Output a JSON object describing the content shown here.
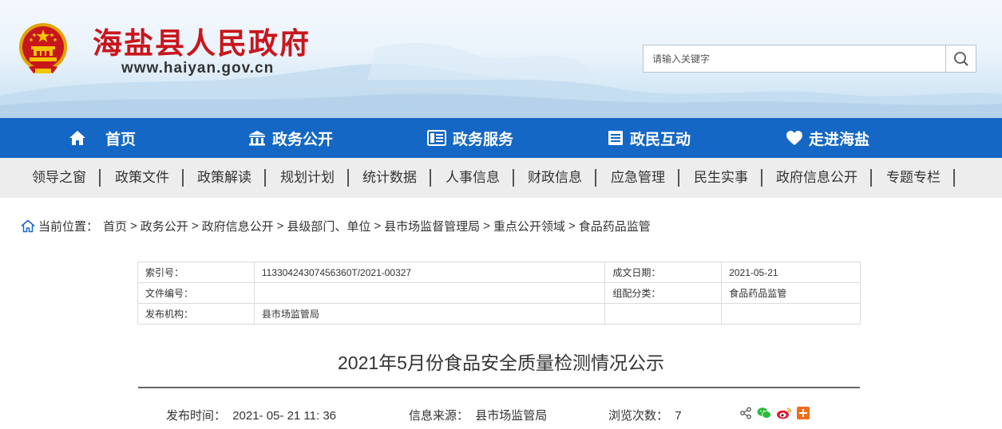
{
  "site": {
    "title": "海盐县人民政府",
    "url": "www.haiyan.gov.cn"
  },
  "search": {
    "placeholder": "请输入关键字"
  },
  "main_nav": [
    {
      "label": "首页",
      "icon": "home-icon"
    },
    {
      "label": "政务公开",
      "icon": "government-building-icon"
    },
    {
      "label": "政务服务",
      "icon": "service-list-icon"
    },
    {
      "label": "政民互动",
      "icon": "document-list-icon"
    },
    {
      "label": "走进海盐",
      "icon": "heart-icon"
    }
  ],
  "sub_nav": [
    "领导之窗",
    "政策文件",
    "政策解读",
    "规划计划",
    "统计数据",
    "人事信息",
    "财政信息",
    "应急管理",
    "民生实事",
    "政府信息公开",
    "专题专栏"
  ],
  "breadcrumb": {
    "label": "当前位置：",
    "items": [
      "首页",
      "政务公开",
      "政府信息公开",
      "县级部门、单位",
      "县市场监督管理局",
      "重点公开领域",
      "食品药品监管"
    ]
  },
  "meta": {
    "index_label": "索引号：",
    "index_value": "11330424307456360T/2021-00327",
    "date_label": "成文日期：",
    "date_value": "2021-05-21",
    "doc_no_label": "文件编号：",
    "doc_no_value": "",
    "category_label": "组配分类：",
    "category_value": "食品药品监管",
    "publisher_label": "发布机构：",
    "publisher_value": "县市场监管局"
  },
  "article": {
    "title": "2021年5月份食品安全质量检测情况公示",
    "publish_time_label": "发布时间：",
    "publish_time": "2021- 05- 21 11: 36",
    "source_label": "信息来源：",
    "source": "县市场监管局",
    "views_label": "浏览次数：",
    "views": "7"
  },
  "colors": {
    "brand_red": "#c8161d",
    "nav_blue": "#1467c4",
    "subnav_gray": "#ededed"
  }
}
